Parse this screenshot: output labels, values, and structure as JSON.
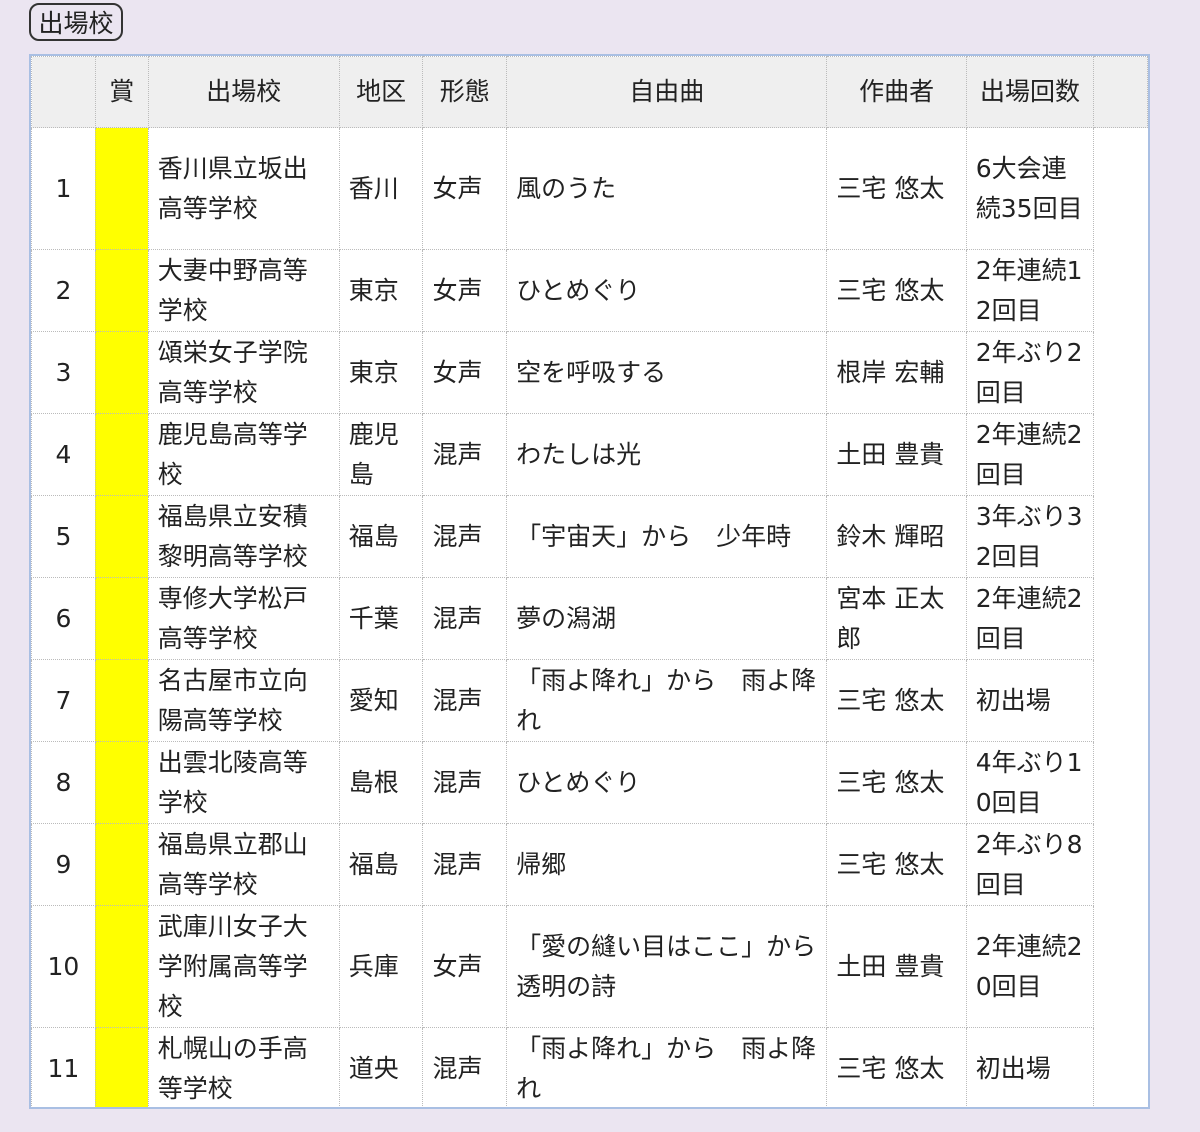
{
  "section_label": "出場校",
  "headers": [
    "",
    "賞",
    "出場校",
    "地区",
    "形態",
    "自由曲",
    "作曲者",
    "出場回数"
  ],
  "rows": [
    {
      "no": "1",
      "prize": "",
      "school": "香川県立坂出高等学校",
      "area": "香川",
      "type": "女声",
      "piece": "風のうた",
      "composer": "三宅 悠太",
      "count": "6大会連続35回目"
    },
    {
      "no": "2",
      "prize": "",
      "school": "大妻中野高等学校",
      "area": "東京",
      "type": "女声",
      "piece": "ひとめぐり",
      "composer": "三宅 悠太",
      "count": "2年連続12回目"
    },
    {
      "no": "3",
      "prize": "",
      "school": "頌栄女子学院高等学校",
      "area": "東京",
      "type": "女声",
      "piece": "空を呼吸する",
      "composer": "根岸 宏輔",
      "count": "2年ぶり2回目"
    },
    {
      "no": "4",
      "prize": "",
      "school": "鹿児島高等学校",
      "area": "鹿児島",
      "type": "混声",
      "piece": "わたしは光",
      "composer": "土田 豊貴",
      "count": "2年連続2回目"
    },
    {
      "no": "5",
      "prize": "",
      "school": "福島県立安積黎明高等学校",
      "area": "福島",
      "type": "混声",
      "piece": "「宇宙天」から　少年時",
      "composer": "鈴木 輝昭",
      "count": "3年ぶり32回目"
    },
    {
      "no": "6",
      "prize": "",
      "school": "専修大学松戸高等学校",
      "area": "千葉",
      "type": "混声",
      "piece": "夢の潟湖",
      "composer": "宮本 正太郎",
      "count": "2年連続2回目"
    },
    {
      "no": "7",
      "prize": "",
      "school": "名古屋市立向陽高等学校",
      "area": "愛知",
      "type": "混声",
      "piece": "「雨よ降れ」から　雨よ降れ",
      "composer": "三宅 悠太",
      "count": "初出場"
    },
    {
      "no": "8",
      "prize": "",
      "school": "出雲北陵高等学校",
      "area": "島根",
      "type": "混声",
      "piece": "ひとめぐり",
      "composer": "三宅 悠太",
      "count": "4年ぶり10回目"
    },
    {
      "no": "9",
      "prize": "",
      "school": "福島県立郡山高等学校",
      "area": "福島",
      "type": "混声",
      "piece": "帰郷",
      "composer": "三宅 悠太",
      "count": "2年ぶり8回目"
    },
    {
      "no": "10",
      "prize": "",
      "school": "武庫川女子大学附属高等学校",
      "area": "兵庫",
      "type": "女声",
      "piece": "「愛の縫い目はここ」から　透明の詩",
      "composer": "土田 豊貴",
      "count": "2年連続20回目"
    },
    {
      "no": "11",
      "prize": "",
      "school": "札幌山の手高等学校",
      "area": "道央",
      "type": "混声",
      "piece": "「雨よ降れ」から　雨よ降れ",
      "composer": "三宅 悠太",
      "count": "初出場"
    }
  ],
  "colors": {
    "prize_fill": "#ffff00",
    "border": "#a9bfe3"
  }
}
